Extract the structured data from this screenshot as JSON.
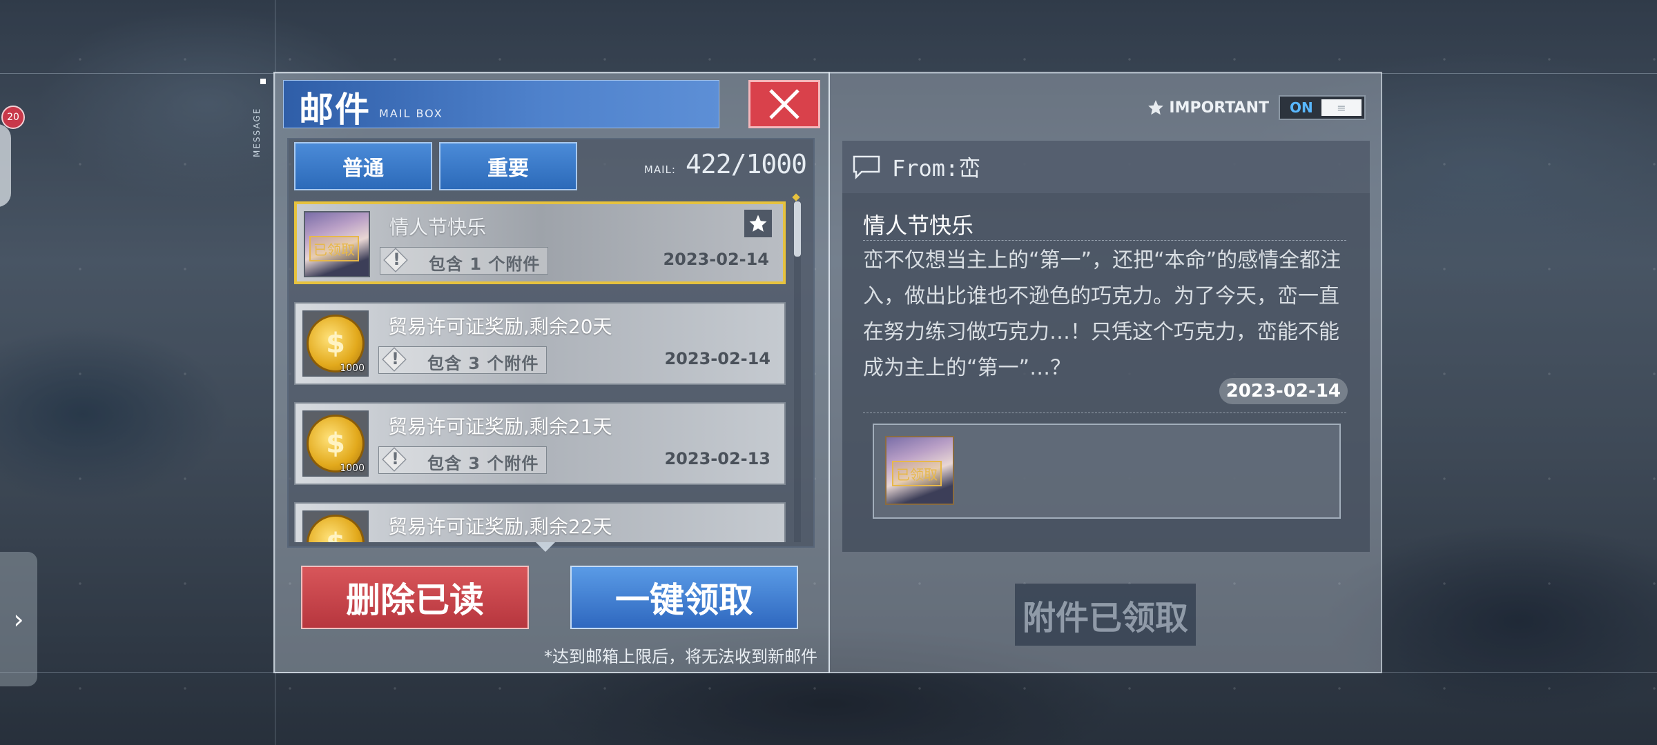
{
  "mailbox": {
    "title_cn": "邮件",
    "title_en": "MAIL BOX",
    "side_label": "MESSAGE",
    "badge_count": "20",
    "tabs": [
      {
        "label": "普通"
      },
      {
        "label": "重要"
      }
    ],
    "mail_label": "MAIL:",
    "mail_count": "422/1000",
    "items": [
      {
        "title": "情人节快乐",
        "attachment": "包含 1 个附件",
        "date": "2023-02-14",
        "thumb": "character-portrait",
        "stamp": "已领取",
        "starred": true
      },
      {
        "title": "贸易许可证奖励,剩余20天",
        "attachment": "包含 3 个附件",
        "date": "2023-02-14",
        "thumb": "gold-coin",
        "qty": "1000"
      },
      {
        "title": "贸易许可证奖励,剩余21天",
        "attachment": "包含 3 个附件",
        "date": "2023-02-13",
        "thumb": "gold-coin",
        "qty": "1000"
      },
      {
        "title": "贸易许可证奖励,剩余22天",
        "thumb": "gold-coin"
      }
    ],
    "delete_read_label": "删除已读",
    "claim_all_label": "一键领取",
    "note": "*达到邮箱上限后，将无法收到新邮件"
  },
  "detail": {
    "important_label": "IMPORTANT",
    "toggle_state": "ON",
    "from": "From:峦",
    "title": "情人节快乐",
    "body": "峦不仅想当主上的“第一”，还把“本命”的感情全都注入，做出比谁也不逊色的巧克力。为了今天，峦一直在努力练习做巧克力…！只凭这个巧克力，峦能不能成为主上的“第一”…？",
    "date": "2023-02-14",
    "attachment_stamp": "已领取",
    "claimed_button": "附件已领取"
  },
  "colors": {
    "accent_blue": "#3f77c6",
    "danger_red": "#d9414b",
    "selected_gold": "#e6c23e"
  }
}
